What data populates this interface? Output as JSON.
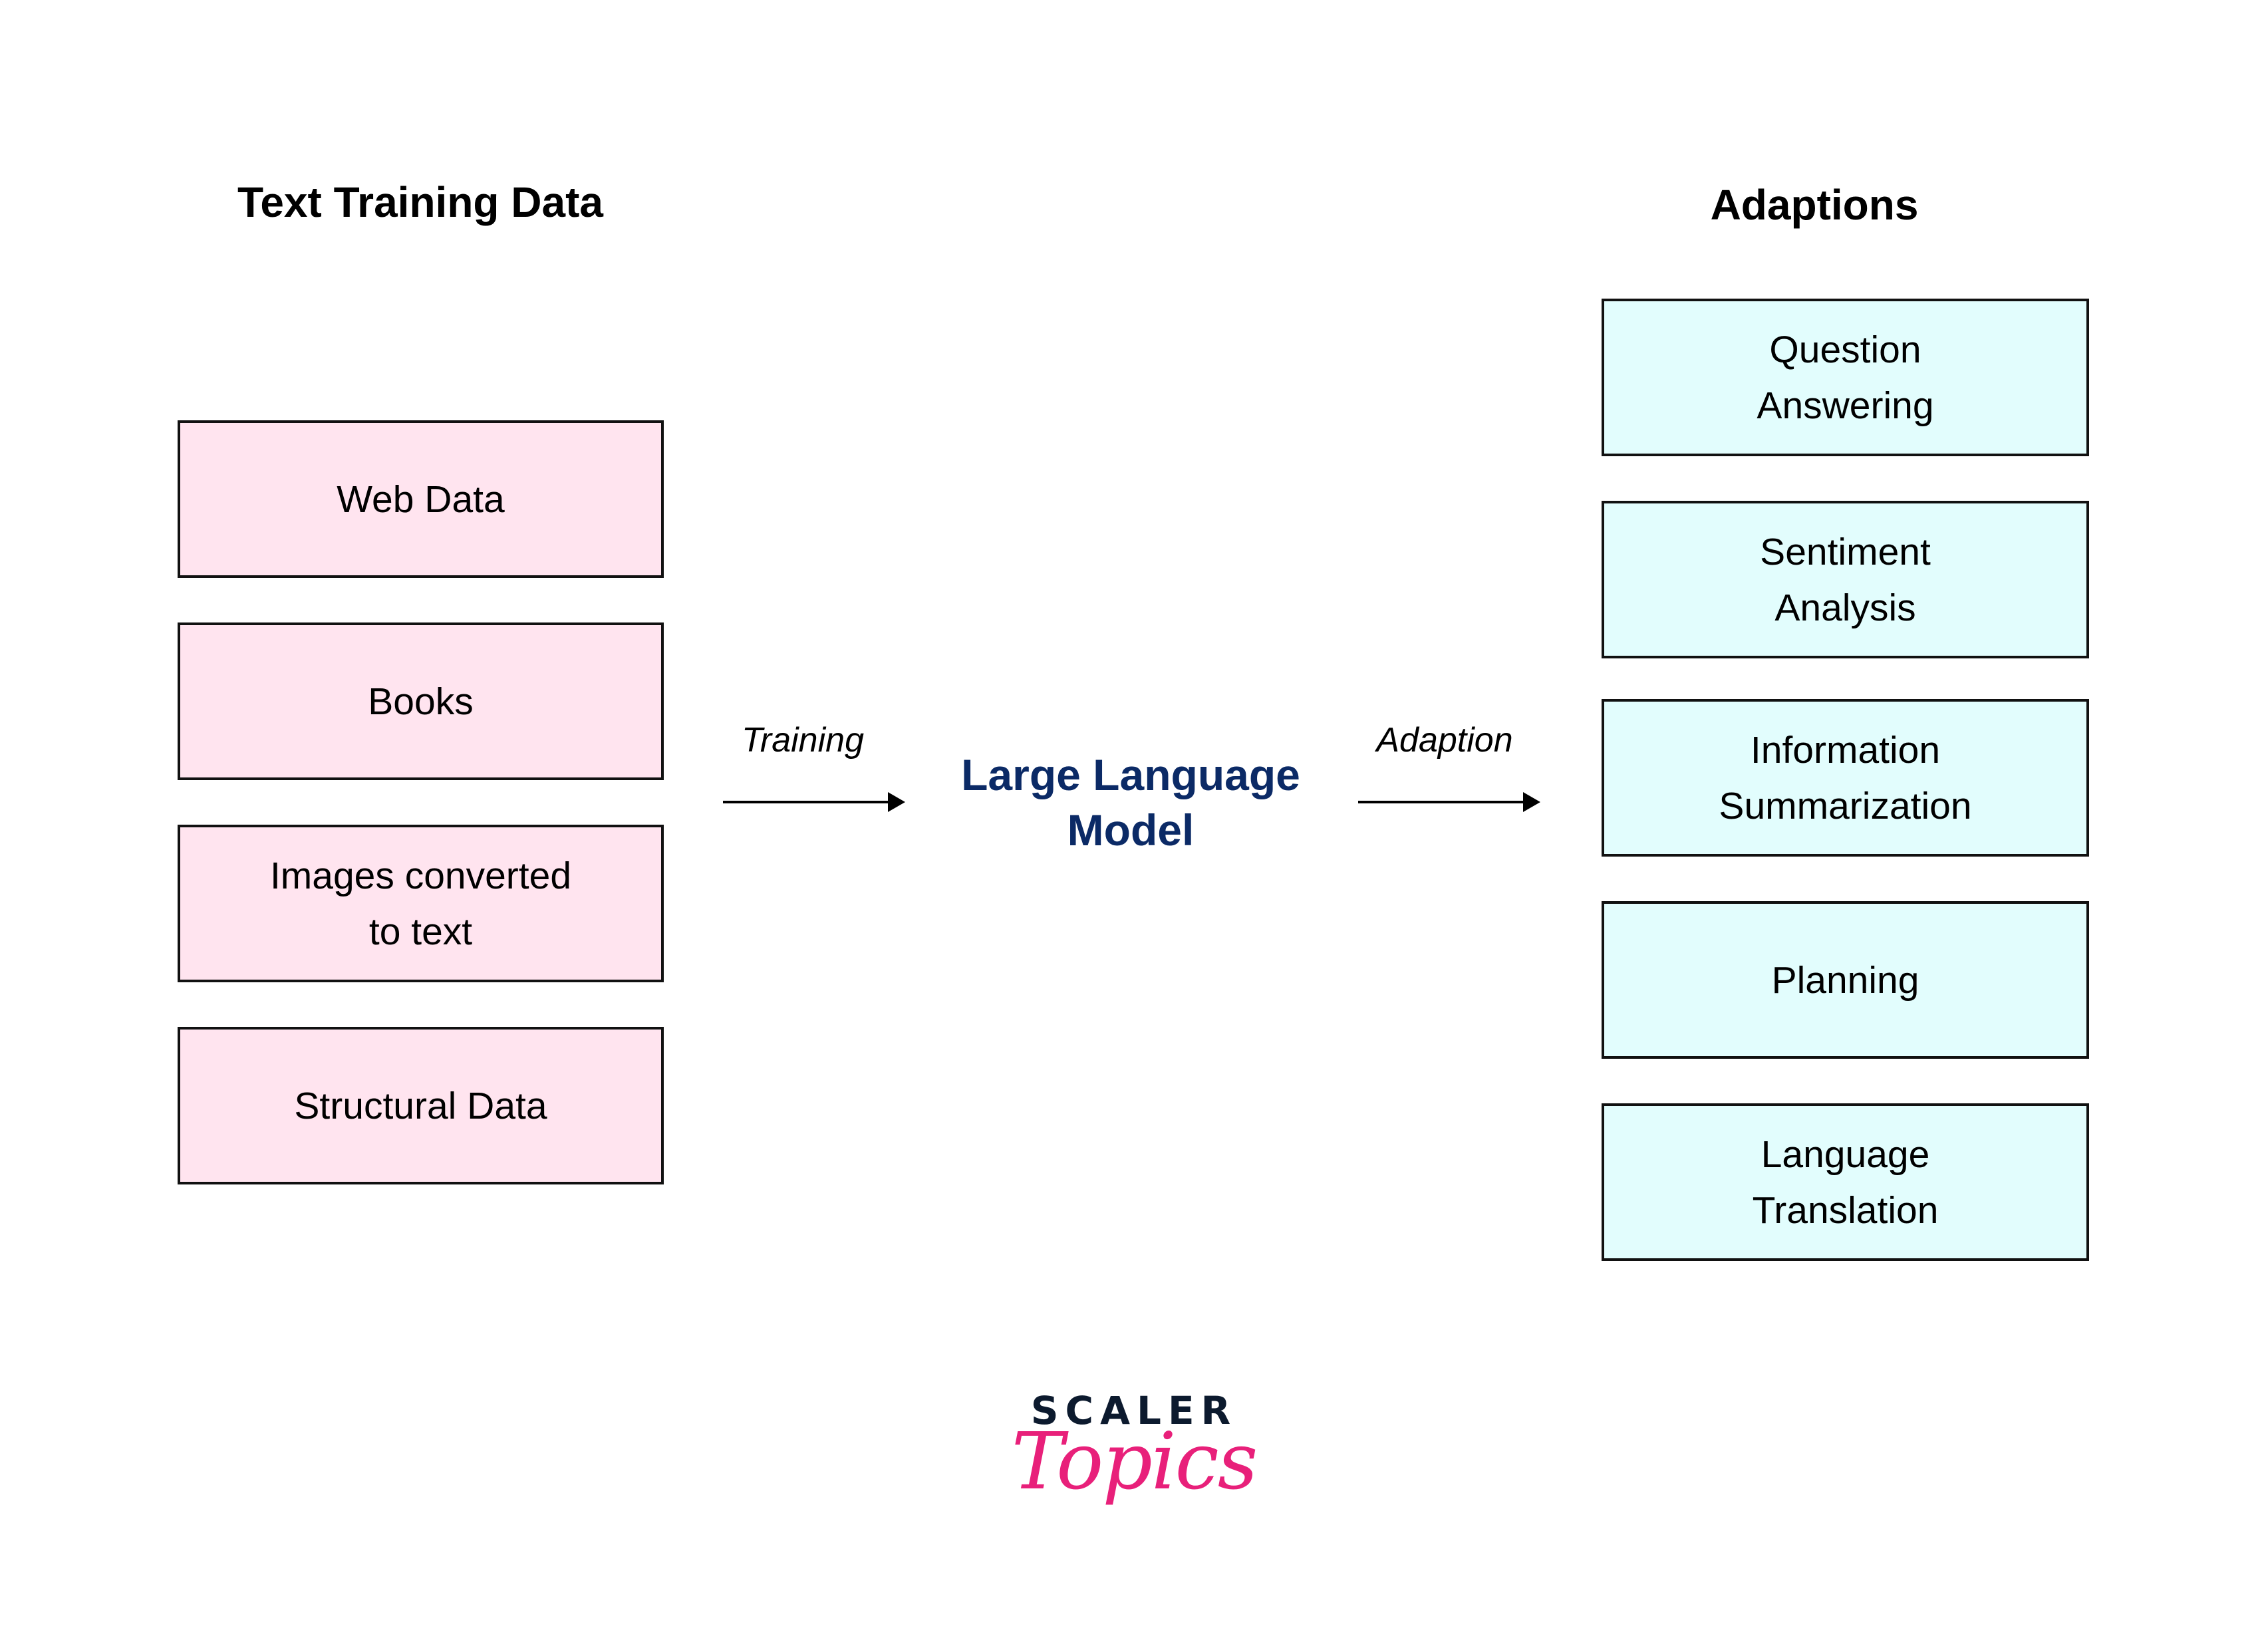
{
  "headings": {
    "left": "Text Training Data",
    "right": "Adaptions"
  },
  "sources": [
    {
      "lines": [
        "Web Data"
      ]
    },
    {
      "lines": [
        "Books"
      ]
    },
    {
      "lines": [
        "Images converted",
        "to text"
      ]
    },
    {
      "lines": [
        "Structural Data"
      ]
    }
  ],
  "center": {
    "lines": [
      "Large Language",
      "Model"
    ],
    "color": "#0b2a66"
  },
  "arrows": {
    "training_label": "Training",
    "adaption_label": "Adaption"
  },
  "adaptions": [
    {
      "lines": [
        "Question",
        "Answering"
      ]
    },
    {
      "lines": [
        "Sentiment",
        "Analysis"
      ]
    },
    {
      "lines": [
        "Information",
        "Summarization"
      ]
    },
    {
      "lines": [
        "Planning"
      ]
    },
    {
      "lines": [
        "Language",
        "Translation"
      ]
    }
  ],
  "colors": {
    "source_fill": "#ffe4ef",
    "adaption_fill": "#e2fdfd",
    "logo_dark": "#0c1a2e",
    "logo_pink": "#e8207a"
  },
  "logo": {
    "word1": "SCALER",
    "word2": "Topics"
  }
}
